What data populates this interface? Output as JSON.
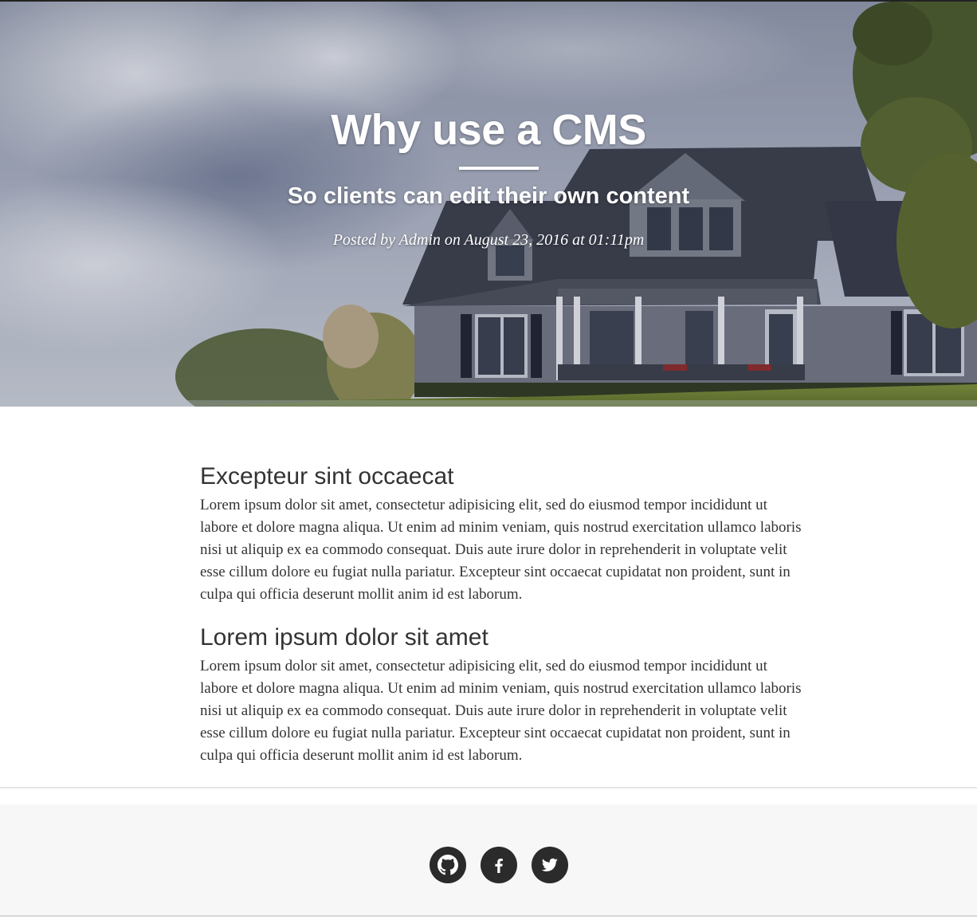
{
  "header": {
    "title": "Why use a CMS",
    "subtitle": "So clients can edit their own content",
    "meta": "Posted by Admin on August 23, 2016 at 01:11pm",
    "background_image": "house-on-hill-photo"
  },
  "article": {
    "sections": [
      {
        "heading": "Excepteur sint occaecat",
        "body": "Lorem ipsum dolor sit amet, consectetur adipisicing elit, sed do eiusmod tempor incididunt ut labore et dolore magna aliqua. Ut enim ad minim veniam, quis nostrud exercitation ullamco laboris nisi ut aliquip ex ea commodo consequat. Duis aute irure dolor in reprehenderit in voluptate velit esse cillum dolore eu fugiat nulla pariatur. Excepteur sint occaecat cupidatat non proident, sunt in culpa qui officia deserunt mollit anim id est laborum."
      },
      {
        "heading": "Lorem ipsum dolor sit amet",
        "body": "Lorem ipsum dolor sit amet, consectetur adipisicing elit, sed do eiusmod tempor incididunt ut labore et dolore magna aliqua. Ut enim ad minim veniam, quis nostrud exercitation ullamco laboris nisi ut aliquip ex ea commodo consequat. Duis aute irure dolor in reprehenderit in voluptate velit esse cillum dolore eu fugiat nulla pariatur. Excepteur sint occaecat cupidatat non proident, sunt in culpa qui officia deserunt mollit anim id est laborum."
      }
    ]
  },
  "footer": {
    "social": [
      {
        "icon": "github-icon"
      },
      {
        "icon": "facebook-icon"
      },
      {
        "icon": "twitter-icon"
      }
    ]
  },
  "colors": {
    "text": "#333333",
    "footer_bg": "#f7f7f7",
    "icon_circle": "#2b2b2b",
    "hero_text": "#ffffff"
  }
}
